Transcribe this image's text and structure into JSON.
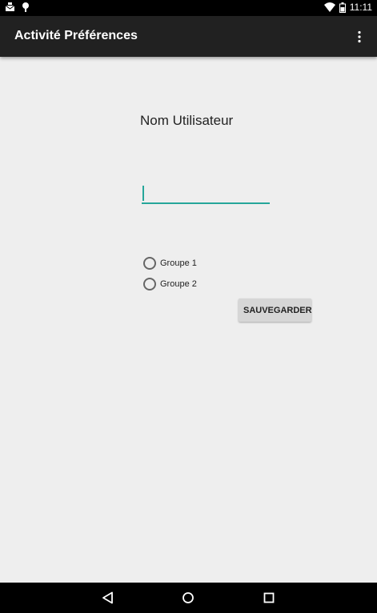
{
  "status_bar": {
    "time": "11:11",
    "left_icons": [
      "mail-notification-icon",
      "android-debug-icon"
    ],
    "right_icons": [
      "wifi-icon",
      "battery-icon"
    ]
  },
  "app_bar": {
    "title": "Activité Préférences",
    "menu_icon": "overflow-menu-icon"
  },
  "form": {
    "username_label": "Nom Utilisateur",
    "username_value": "",
    "username_placeholder": "",
    "radio_options": [
      {
        "label": "Groupe 1",
        "selected": false
      },
      {
        "label": "Groupe 2",
        "selected": false
      }
    ],
    "save_label": "SAUVEGARDER"
  },
  "nav_bar": {
    "buttons": [
      "back-icon",
      "home-icon",
      "recents-icon"
    ]
  },
  "colors": {
    "accent": "#26a69a",
    "app_bar": "#212121",
    "background": "#eeeeee"
  }
}
